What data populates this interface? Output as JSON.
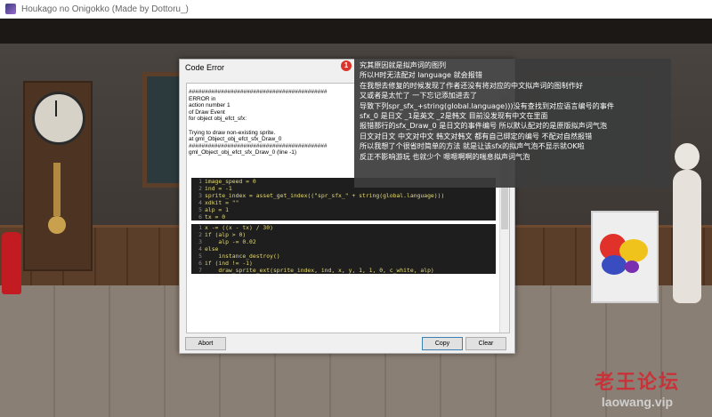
{
  "window": {
    "title": "Houkago no Onigokko (Made by Dottoru_)"
  },
  "dialog": {
    "title": "Code Error",
    "error_lines": [
      "###########################################",
      "ERROR in",
      "action number 1",
      "of Draw Event",
      "for object obj_efct_sfx:",
      "",
      "Trying to draw non-existing sprite.",
      "at gml_Object_obj_efct_sfx_Draw_0",
      "###########################################",
      "gml_Object_obj_efct_sfx_Draw_0 (line -1)"
    ],
    "code_block_1": [
      {
        "n": "1",
        "code": "image_speed = 0"
      },
      {
        "n": "2",
        "code": "ind = -1"
      },
      {
        "n": "3",
        "code": "sprite_index = asset_get_index((\"spr_sfx_\" + string(global.language)))"
      },
      {
        "n": "4",
        "code": "xdkit = \"\""
      },
      {
        "n": "5",
        "code": "alp = 1"
      },
      {
        "n": "6",
        "code": "tx = 0"
      }
    ],
    "code_block_2": [
      {
        "n": "1",
        "code": "x -= ((x - tx) / 30)"
      },
      {
        "n": "2",
        "code": "if (alp > 0)"
      },
      {
        "n": "3",
        "code": "    alp -= 0.02"
      },
      {
        "n": "4",
        "code": "else"
      },
      {
        "n": "5",
        "code": "    instance_destroy()"
      },
      {
        "n": "6",
        "code": "if (ind != -1)"
      },
      {
        "n": "7",
        "code": "    draw_sprite_ext(sprite_index, ind, x, y, 1, 1, 0, c_white, alp)"
      }
    ],
    "buttons": {
      "abort": "Abort",
      "copy": "Copy",
      "clear": "Clear"
    }
  },
  "annotation": {
    "badge": "1",
    "lines": [
      "究其原因就是拟声词的图列",
      "所以H时无法配对 language 就会报错",
      "在我想去修复的时候发现了作者还没有将对应的中文拟声词的图制作好",
      "又或者是太忙了 一下忘记添加进去了",
      "导致下列spr_sfx_+string(global.language)))没有查找到对应语言编号的事件",
      "sfx_0 是日文 _1是英文 _2是韩文 目前没发现有中文在里面",
      "报错那行的sfx_Draw_0 是日文的事件编号 所以默认配对的是原版拟声词气泡",
      "日文对日文 中文对中文 韩文对韩文 都有自己绑定的编号 不配对自然报错",
      "所以我想了个很省时简单的方法 就是让该sfx的拟声气泡不显示就OK啦",
      "反正不影响游玩 也就少个 嗯嗯啊啊的喘息拟声词气泡"
    ]
  },
  "watermark": {
    "cn": "老王论坛",
    "en": "laowang.vip"
  }
}
